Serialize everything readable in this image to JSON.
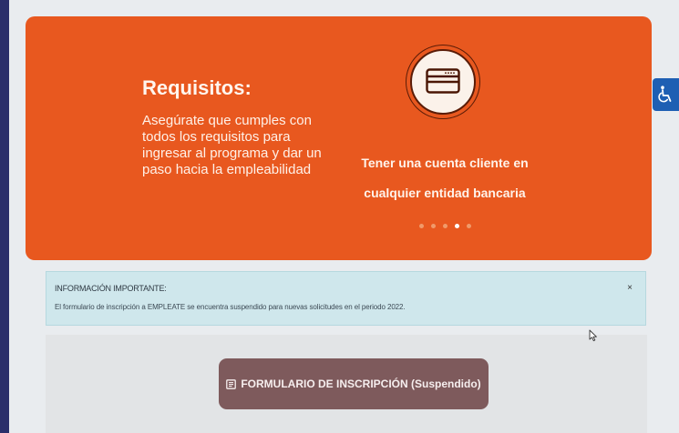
{
  "hero": {
    "title": "Requisitos:",
    "description": "Asegúrate que cumples con todos los requisitos para ingresar al programa y dar un paso hacia la empleabilidad",
    "slide_icon": "credit-card-icon",
    "slide_text_line1": "Tener una cuenta cliente en",
    "slide_text_line2": "cualquier entidad bancaria",
    "carousel": {
      "total_slides": 5,
      "active_slide": 4
    }
  },
  "accessibility": {
    "icon": "wheelchair-icon"
  },
  "alert": {
    "title": "INFORMACIÓN IMPORTANTE:",
    "message": "El formulario de inscripción a EMPLEATE se encuentra suspendido para nuevas solicitudes en el periodo 2022.",
    "close_label": "×"
  },
  "form_button": {
    "icon": "form-icon",
    "label": "FORMULARIO DE INSCRIPCIÓN (Suspendido)"
  },
  "colors": {
    "hero_orange": "#e8581f",
    "alert_bg": "#cfe7ec",
    "button_bg": "#7e5a5c",
    "accessibility_blue": "#1e5fb3"
  }
}
